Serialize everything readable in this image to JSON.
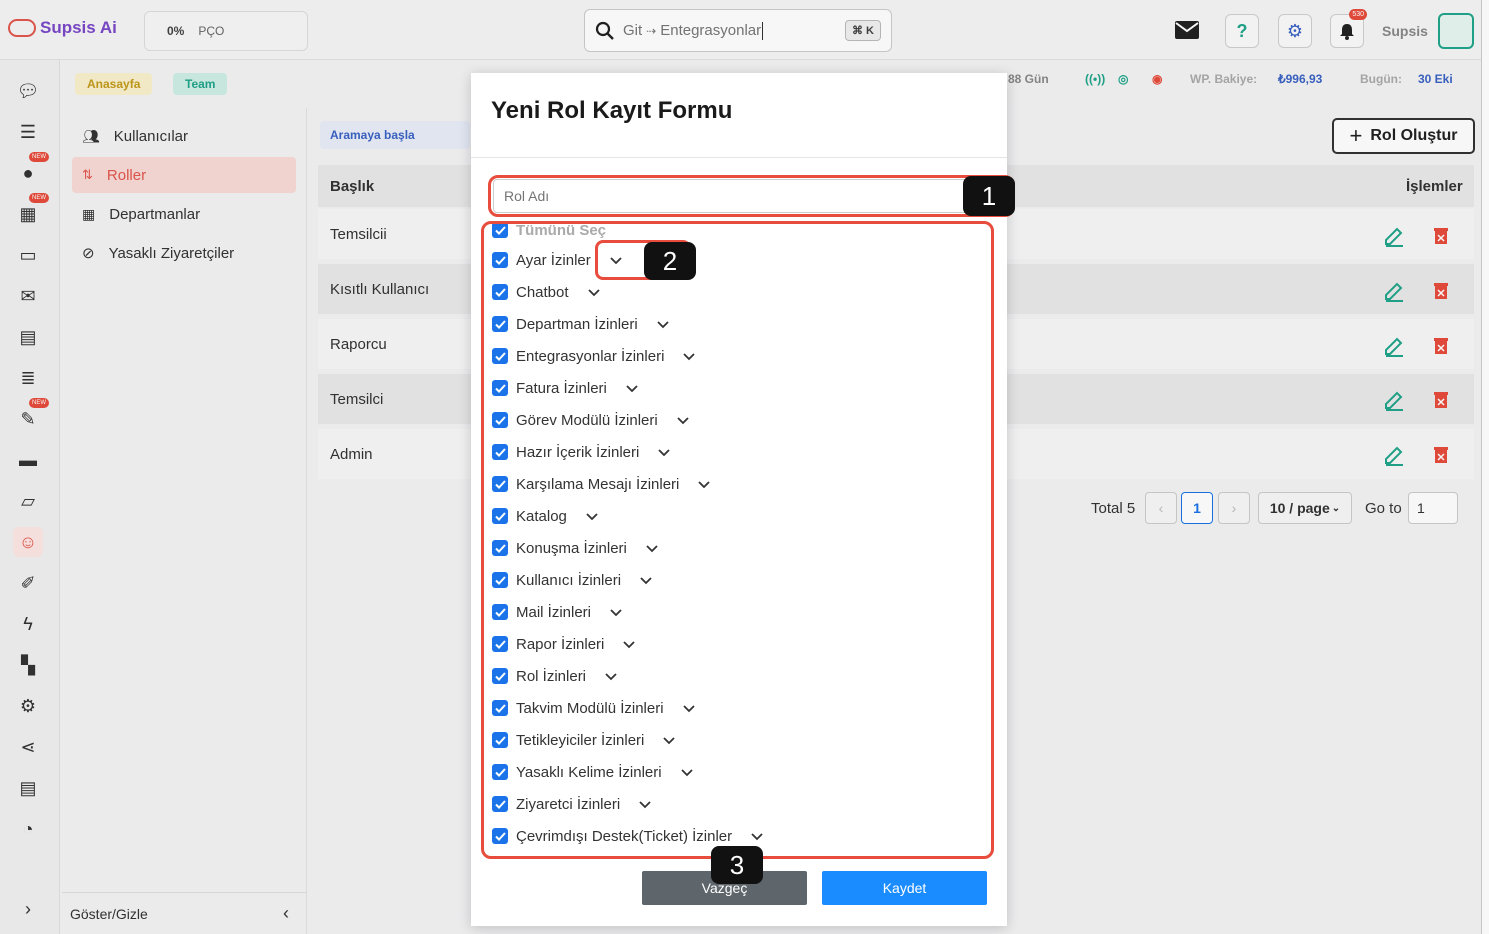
{
  "app": {
    "brand": "Supsis Ai",
    "percent": "0%",
    "pco": "PÇO",
    "user": "Supsis",
    "notif_count": "530"
  },
  "search": {
    "prefix": "Git",
    "arrow": "⇢",
    "text": "Entegrasyonlar",
    "shortcut": "⌘ K"
  },
  "header": {
    "chip_home": "Anasayfa",
    "chip_team": "Team",
    "days": "88 Gün",
    "balance_label": "WP. Bakiye:",
    "balance_value": "₺996,93",
    "today_label": "Bugün:",
    "today_value": "30 Eki"
  },
  "menu": {
    "items": [
      {
        "label": "Kullanıcılar",
        "icon": "users-icon"
      },
      {
        "label": "Roller",
        "icon": "roles-icon"
      },
      {
        "label": "Departmanlar",
        "icon": "building-icon"
      },
      {
        "label": "Yasaklı Ziyaretçiler",
        "icon": "ban-icon"
      }
    ],
    "toggle_label": "Göster/Gizle"
  },
  "table": {
    "search_label": "Aramaya başla",
    "create_button": "Rol Oluştur",
    "col_title": "Başlık",
    "col_actions": "İşlemler",
    "rows": [
      "Temsilcii",
      "Kısıtlı Kullanıcı",
      "Raporcu",
      "Temsilci",
      "Admin"
    ],
    "total": "Total 5",
    "page": "1",
    "page_size": "10 / page",
    "goto_label": "Go to",
    "goto_value": "1"
  },
  "modal": {
    "title": "Yeni Rol Kayıt Formu",
    "role_name_placeholder": "Rol Adı",
    "select_all": "Tümünü Seç",
    "permissions": [
      "Ayar İzinler",
      "Chatbot",
      "Departman İzinleri",
      "Entegrasyonlar İzinleri",
      "Fatura İzinleri",
      "Görev Modülü İzinleri",
      "Hazır İçerik İzinleri",
      "Karşılama Mesajı İzinleri",
      "Katalog",
      "Konuşma İzinleri",
      "Kullanıcı İzinleri",
      "Mail İzinleri",
      "Rapor İzinleri",
      "Rol İzinleri",
      "Takvim Modülü İzinleri",
      "Tetikleyiciler İzinleri",
      "Yasaklı Kelime İzinleri",
      "Ziyaretci İzinleri",
      "Çevrimdışı Destek(Ticket) İzinler"
    ],
    "cancel": "Vazgeç",
    "save": "Kaydet"
  },
  "annotations": {
    "one": "1",
    "two": "2",
    "three": "3"
  },
  "colors": {
    "accent": "#e0574d",
    "primary": "#1a8cff",
    "checkbox": "#1a73e8",
    "highlight": "#e74c3c"
  }
}
